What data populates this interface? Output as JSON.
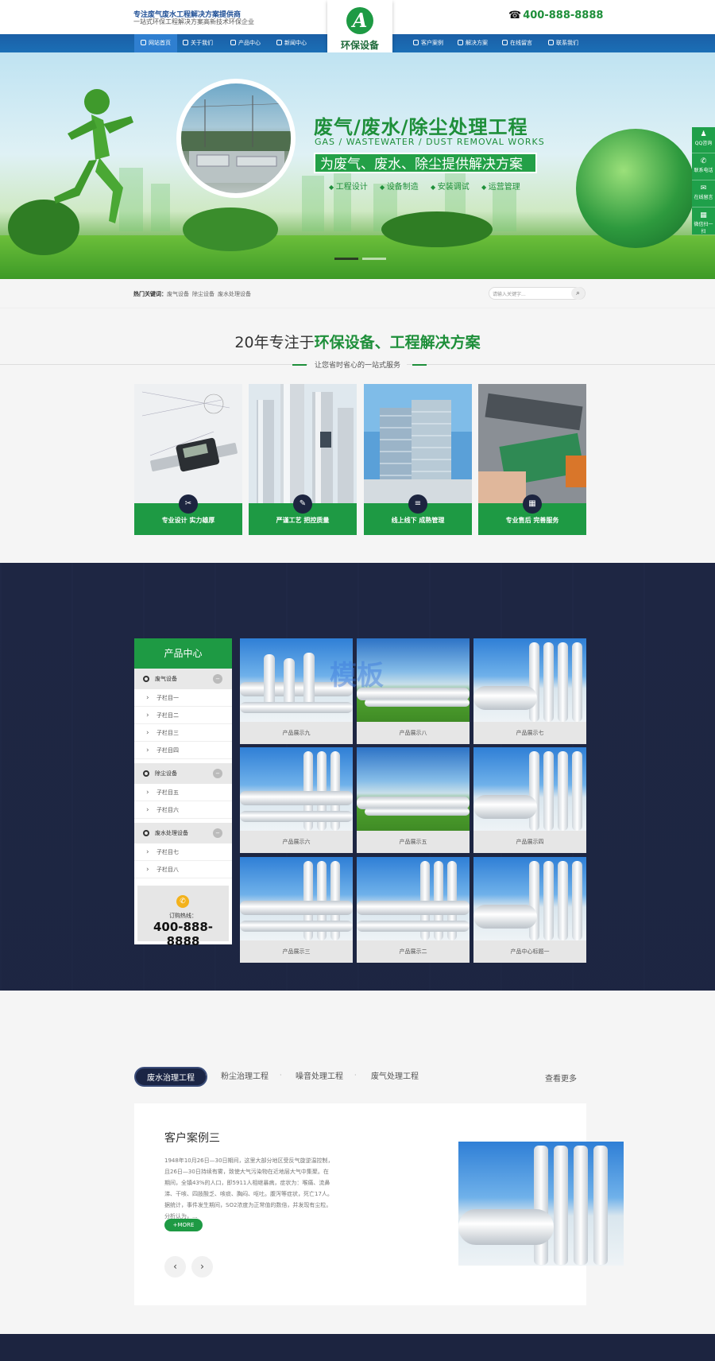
{
  "header": {
    "slogan_main": "专注废气废水工程解决方案提供商",
    "slogan_sub": "一站式环保工程解决方案高新技术环保企业",
    "logo_text": "环保设备",
    "logo_letter": "A",
    "phone_icon": "☎",
    "hotline": "400-888-8888"
  },
  "nav": {
    "items": [
      "网站首页",
      "关于我们",
      "产品中心",
      "新闻中心",
      "客户案例",
      "解决方案",
      "在线留言",
      "联系我们"
    ],
    "active_index": 0
  },
  "banner": {
    "headline": "废气/废水/除尘处理工程",
    "headline_en": "GAS / WASTEWATER / DUST REMOVAL WORKS",
    "tagline": "为废气、废水、除尘提供解决方案",
    "features": [
      "工程设计",
      "设备制造",
      "安装调试",
      "运营管理"
    ],
    "slides": 2,
    "active_slide": 0
  },
  "side_float": [
    {
      "icon": "qq-icon",
      "label": "QQ咨询"
    },
    {
      "icon": "phone-icon",
      "label": "联系电话"
    },
    {
      "icon": "chat-icon",
      "label": "在线留言"
    },
    {
      "icon": "qrcode-icon",
      "label": "微信扫一扫"
    }
  ],
  "keywords": {
    "label": "热门关键词：",
    "items": [
      "废气设备",
      "除尘设备",
      "废水处理设备"
    ],
    "search_placeholder": "请输入关键字..."
  },
  "advantages": {
    "title_plain": "20年专注于",
    "title_highlight": "环保设备、工程解决方案",
    "subtitle": "让您省时省心的一站式服务",
    "cards": [
      {
        "label": "专业设计 实力雄厚",
        "icon": "tools-icon"
      },
      {
        "label": "严谨工艺 把控质量",
        "icon": "hand-icon"
      },
      {
        "label": "线上线下 成熟管理",
        "icon": "sliders-icon"
      },
      {
        "label": "专业售后 完善服务",
        "icon": "grid-icon"
      }
    ]
  },
  "products": {
    "heading": "产品中心",
    "categories": [
      {
        "name": "废气设备",
        "toggle": "−",
        "subs": [
          "子栏目一",
          "子栏目二",
          "子栏目三",
          "子栏目四"
        ]
      },
      {
        "name": "除尘设备",
        "toggle": "−",
        "subs": [
          "子栏目五",
          "子栏目六"
        ]
      },
      {
        "name": "废水处理设备",
        "toggle": "−",
        "subs": [
          "子栏目七",
          "子栏目八"
        ]
      }
    ],
    "call_label": "订购热线：",
    "call_number": "400-888-8888",
    "tiles": [
      "产品展示九",
      "产品展示八",
      "产品展示七",
      "产品展示六",
      "产品展示五",
      "产品展示四",
      "产品展示三",
      "产品展示二",
      "产品中心标题一"
    ],
    "watermark": "模板"
  },
  "cases": {
    "tabs": [
      "废水治理工程",
      "粉尘治理工程",
      "噪音处理工程",
      "废气处理工程"
    ],
    "active_tab": 0,
    "more": "查看更多",
    "title": "客户案例三",
    "text": "1948年10月26日—30日期间，这里大部分地区受反气旋逆温控制，且26日—30日持续有雾，致使大气污染物在近地层大气中集聚。在期间，全镇43%的人口，即5911人相继暴病，症状为：喉痛、流鼻涕、干咳、四肢酸乏、咳痰、胸闷、呕吐。腹泻等症状，死亡17人。据统计，事件发生期间，SO2浓度为正常值的数倍，并发现有尘粒。分析认为，...",
    "more_btn": "+MORE",
    "prev": "‹",
    "next": "›"
  },
  "colors": {
    "green": "#1e9a44",
    "navy": "#1c2440",
    "blue": "#1b5fa6"
  }
}
